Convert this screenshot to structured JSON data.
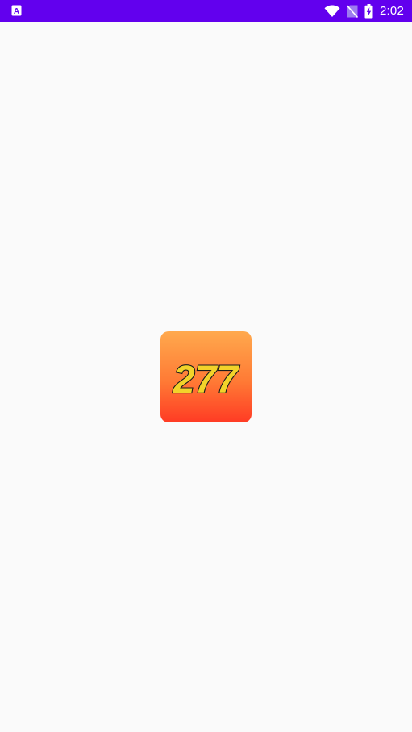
{
  "status_bar": {
    "time": "2:02",
    "left_icon": "keyboard-a-icon",
    "icons": [
      "wifi-icon",
      "no-sim-icon",
      "battery-charging-icon"
    ],
    "background_color": "#6200ee"
  },
  "splash": {
    "logo_text": "277",
    "logo_icon": "app-logo-icon",
    "background_color": "#fafafa"
  }
}
